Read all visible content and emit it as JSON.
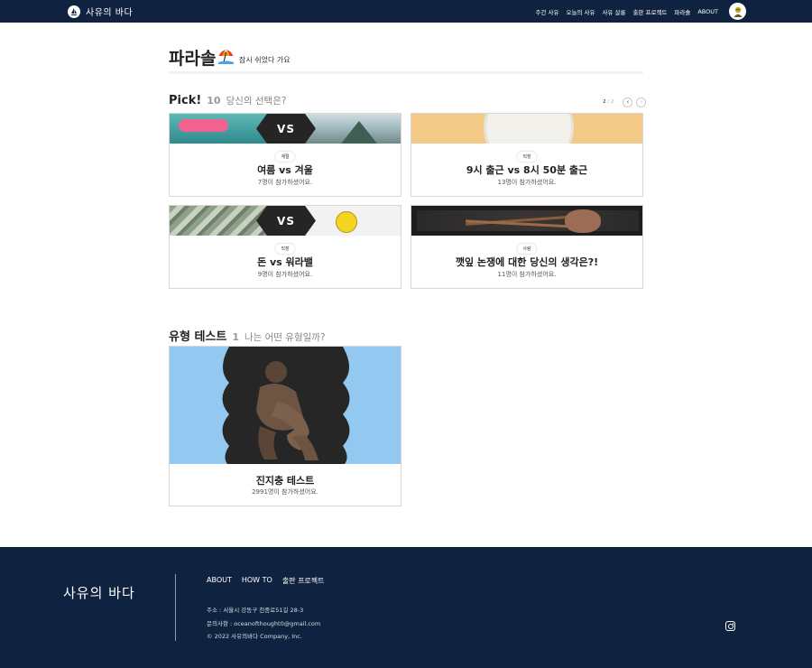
{
  "header": {
    "brand": "사유의 바다",
    "nav": [
      "주간 사유",
      "오늘의 사유",
      "사유 살롱",
      "출판 프로젝트",
      "파라솔",
      "ABOUT"
    ]
  },
  "page": {
    "title": "파라솔",
    "subtitle": "잠시 쉬었다 가요"
  },
  "pick": {
    "title": "Pick!",
    "count": "10",
    "subtitle": "당신의 선택은?",
    "pager": {
      "current": "2",
      "separator": " / ",
      "total": "2"
    },
    "vs_label": "VS",
    "cards": [
      {
        "tag": "계절",
        "title": "여름 vs 겨울",
        "count": "7명이 참가하셨어요."
      },
      {
        "tag": "직장",
        "title": "9시 출근 vs 8시 50분 출근",
        "count": "13명이 참가하셨어요."
      },
      {
        "tag": "직장",
        "title": "돈 vs 워라밸",
        "count": "9명이 참가하셨어요."
      },
      {
        "tag": "사랑",
        "title": "깻잎 논쟁에 대한 당신의 생각은?!",
        "count": "11명이 참가하셨어요."
      }
    ]
  },
  "typetest": {
    "title": "유형 테스트",
    "count": "1",
    "subtitle": "나는 어떤 유형일까?",
    "card": {
      "title": "진지충 테스트",
      "count": "2991명이 참가하셨어요."
    }
  },
  "footer": {
    "brand": "사유의 바다",
    "links": [
      "ABOUT",
      "HOW TO",
      "출판 프로젝트"
    ],
    "address": "주소 : 서울시 강동구 천중로51길 28-3",
    "contact": "문의사항 : oceanofthought0@gmail.com",
    "copyright": "© 2022 사유의바다 Company, Inc."
  },
  "colors": {
    "navy": "#0f2340",
    "card_border": "#d6d6d6",
    "muted": "#888888"
  }
}
